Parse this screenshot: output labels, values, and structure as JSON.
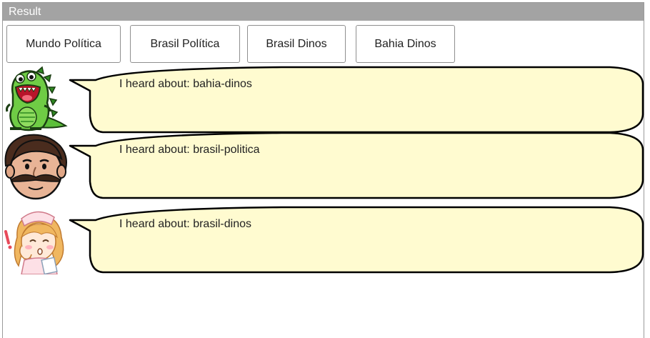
{
  "panel": {
    "title": "Result"
  },
  "buttons": [
    {
      "label": "Mundo Política"
    },
    {
      "label": "Brasil Política"
    },
    {
      "label": "Brasil Dinos"
    },
    {
      "label": "Bahia Dinos"
    }
  ],
  "messages": [
    {
      "avatar": "green-dinosaur-icon",
      "text": "I heard about: bahia-dinos"
    },
    {
      "avatar": "mustache-man-icon",
      "text": "I heard about: brasil-politica"
    },
    {
      "avatar": "nurse-girl-icon",
      "text": "I heard about: brasil-dinos"
    }
  ],
  "colors": {
    "titlebar": "#a3a3a3",
    "bubble_fill": "#fffbd0",
    "bubble_stroke": "#000000"
  }
}
